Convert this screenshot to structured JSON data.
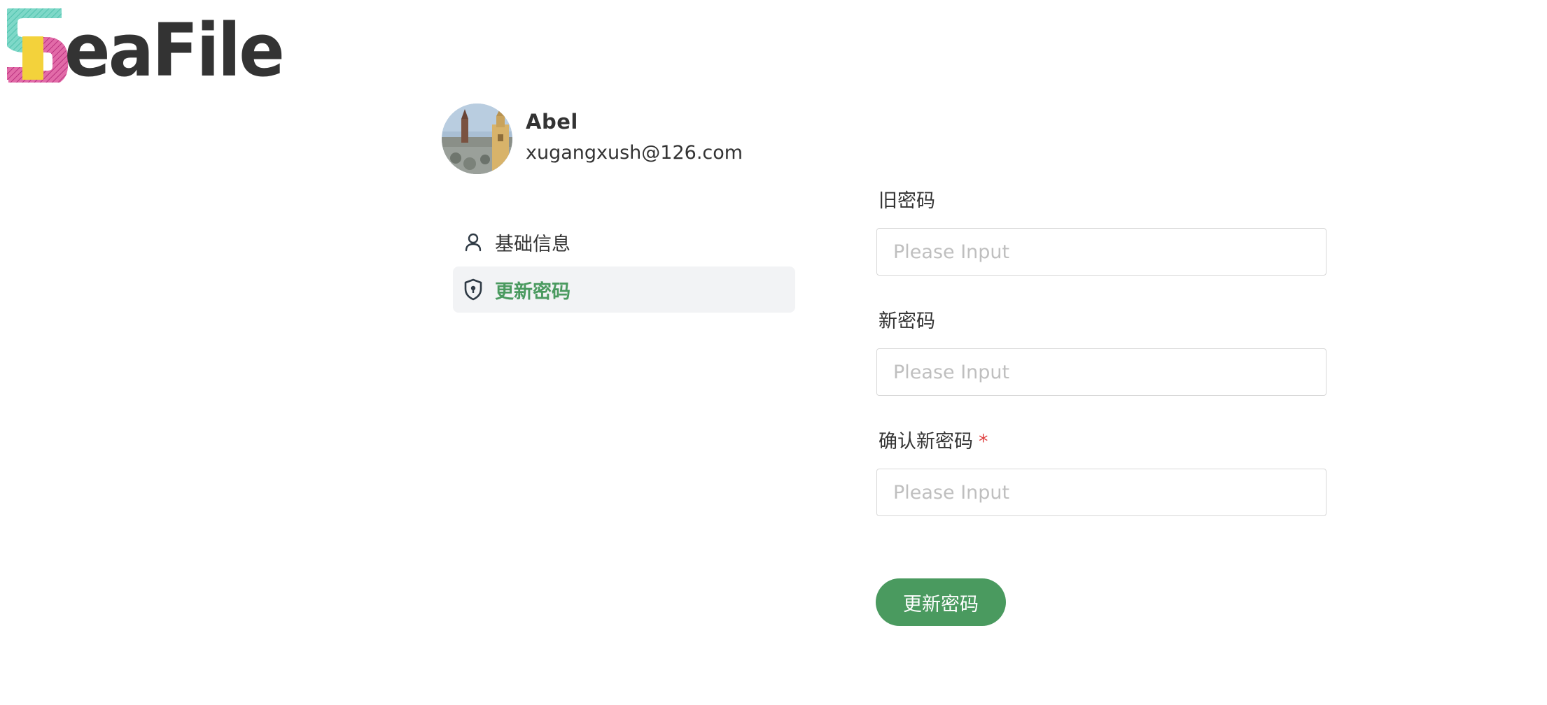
{
  "brand": {
    "logo_text": "SeaFile"
  },
  "profile": {
    "name": "Abel",
    "email": "xugangxush@126.com"
  },
  "nav": {
    "items": [
      {
        "label": "基础信息",
        "icon": "user-icon",
        "active": false
      },
      {
        "label": "更新密码",
        "icon": "shield-icon",
        "active": true
      }
    ]
  },
  "form": {
    "old_password": {
      "label": "旧密码",
      "placeholder": "Please Input",
      "value": ""
    },
    "new_password": {
      "label": "新密码",
      "placeholder": "Please Input",
      "value": ""
    },
    "confirm_password": {
      "label": "确认新密码",
      "required_mark": "*",
      "placeholder": "Please Input",
      "value": ""
    },
    "submit_label": "更新密码"
  },
  "colors": {
    "accent": "#4a9a5f",
    "required": "#e04545",
    "nav_active_bg": "#f2f3f5"
  }
}
